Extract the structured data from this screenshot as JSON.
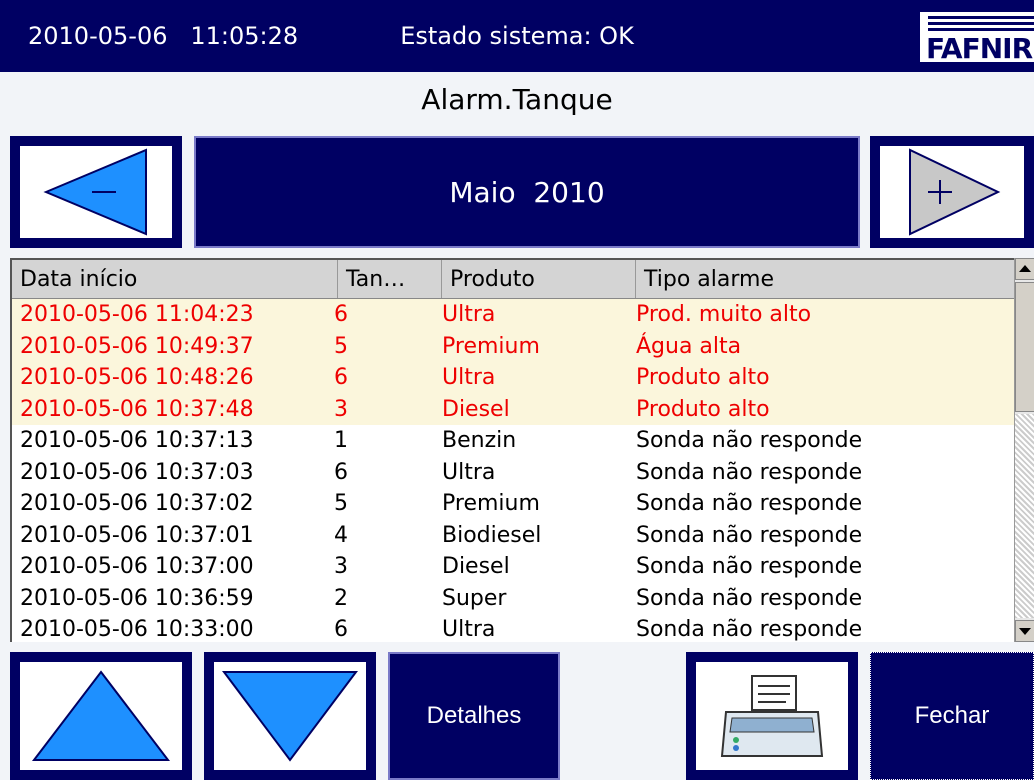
{
  "header": {
    "datetime": "2010-05-06   11:05:28",
    "system_status": "Estado sistema: OK",
    "logo_text": "FAFNIR"
  },
  "title": "Alarm.Tanque",
  "month_nav": {
    "month": "Maio  2010",
    "prev_icon": "arrow-left-icon",
    "next_icon": "arrow-right-icon"
  },
  "table": {
    "columns": [
      "Data início",
      "Tan…",
      "Produto",
      "Tipo alarme"
    ],
    "rows": [
      {
        "date": "2010-05-06 11:04:23",
        "tank": "6",
        "product": "Ultra",
        "type": "Prod. muito alto",
        "active": true
      },
      {
        "date": "2010-05-06 10:49:37",
        "tank": "5",
        "product": "Premium",
        "type": "Água alta",
        "active": true
      },
      {
        "date": "2010-05-06 10:48:26",
        "tank": "6",
        "product": "Ultra",
        "type": "Produto alto",
        "active": true
      },
      {
        "date": "2010-05-06 10:37:48",
        "tank": "3",
        "product": "Diesel",
        "type": "Produto alto",
        "active": true
      },
      {
        "date": "2010-05-06 10:37:13",
        "tank": "1",
        "product": "Benzin",
        "type": "Sonda não responde",
        "active": false
      },
      {
        "date": "2010-05-06 10:37:03",
        "tank": "6",
        "product": "Ultra",
        "type": "Sonda não responde",
        "active": false
      },
      {
        "date": "2010-05-06 10:37:02",
        "tank": "5",
        "product": "Premium",
        "type": "Sonda não responde",
        "active": false
      },
      {
        "date": "2010-05-06 10:37:01",
        "tank": "4",
        "product": "Biodiesel",
        "type": "Sonda não responde",
        "active": false
      },
      {
        "date": "2010-05-06 10:37:00",
        "tank": "3",
        "product": "Diesel",
        "type": "Sonda não responde",
        "active": false
      },
      {
        "date": "2010-05-06 10:36:59",
        "tank": "2",
        "product": "Super",
        "type": "Sonda não responde",
        "active": false
      },
      {
        "date": "2010-05-06 10:33:00",
        "tank": "6",
        "product": "Ultra",
        "type": "Sonda não responde",
        "active": false
      }
    ]
  },
  "buttons": {
    "scroll_up_icon": "triangle-up-icon",
    "scroll_down_icon": "triangle-down-icon",
    "details": "Detalhes",
    "print_icon": "printer-icon",
    "close": "Fechar"
  },
  "colors": {
    "header_bg": "#000063",
    "alarm_text": "#ee0000",
    "alarm_row_bg": "#fbf6dc",
    "arrow_blue": "#1e90ff"
  }
}
